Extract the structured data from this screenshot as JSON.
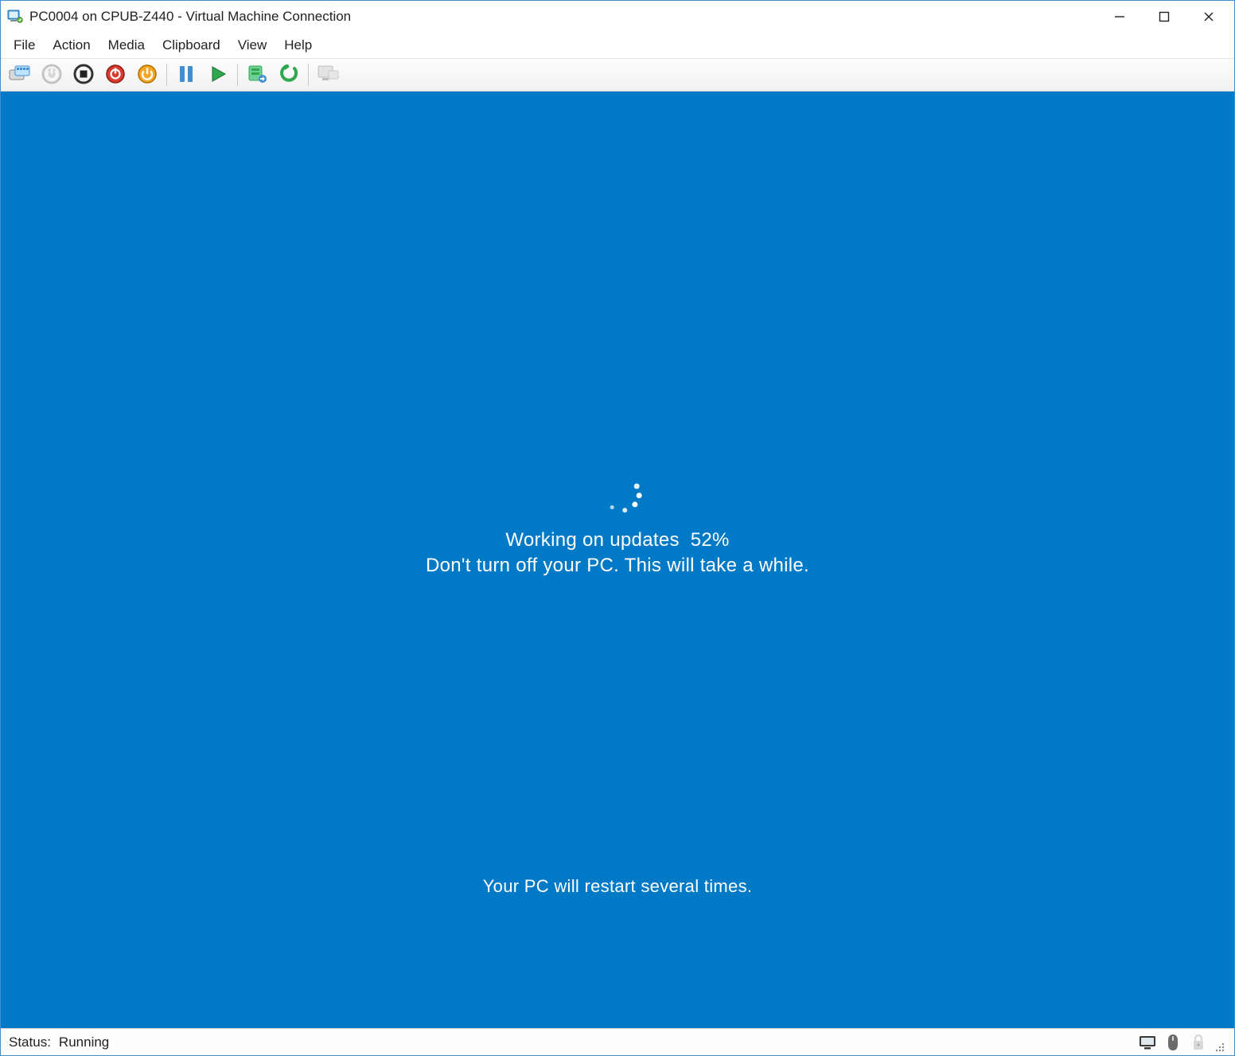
{
  "colors": {
    "guest_bg": "#0079c7",
    "window_border": "#3f8fd4"
  },
  "window": {
    "title": "PC0004 on CPUB-Z440 - Virtual Machine Connection"
  },
  "window_controls": {
    "minimize": "—",
    "maximize": "▢",
    "close": "✕"
  },
  "menu": {
    "items": [
      "File",
      "Action",
      "Media",
      "Clipboard",
      "View",
      "Help"
    ]
  },
  "toolbar": {
    "buttons": [
      {
        "name": "ctrl-alt-del-button",
        "icon": "ctrl-alt-del-icon"
      },
      {
        "name": "start-button",
        "icon": "power-on-icon",
        "disabled": true
      },
      {
        "name": "turn-off-button",
        "icon": "stop-icon"
      },
      {
        "name": "shut-down-button",
        "icon": "shutdown-icon"
      },
      {
        "name": "save-state-button",
        "icon": "save-state-icon"
      },
      {
        "sep": true
      },
      {
        "name": "pause-button",
        "icon": "pause-icon"
      },
      {
        "name": "reset-button",
        "icon": "play-icon"
      },
      {
        "sep": true
      },
      {
        "name": "checkpoint-button",
        "icon": "checkpoint-icon"
      },
      {
        "name": "revert-button",
        "icon": "revert-icon"
      },
      {
        "sep": true
      },
      {
        "name": "enhanced-session-button",
        "icon": "enhanced-session-icon",
        "disabled": true
      }
    ]
  },
  "guest": {
    "progress_label": "Working on updates",
    "progress_percent": "52%",
    "warning": "Don't turn off your PC. This will take a while.",
    "restart_note": "Your PC will restart several times."
  },
  "status": {
    "label": "Status:",
    "value": "Running",
    "icons": [
      "display-icon",
      "input-device-icon",
      "security-lock-icon"
    ]
  }
}
